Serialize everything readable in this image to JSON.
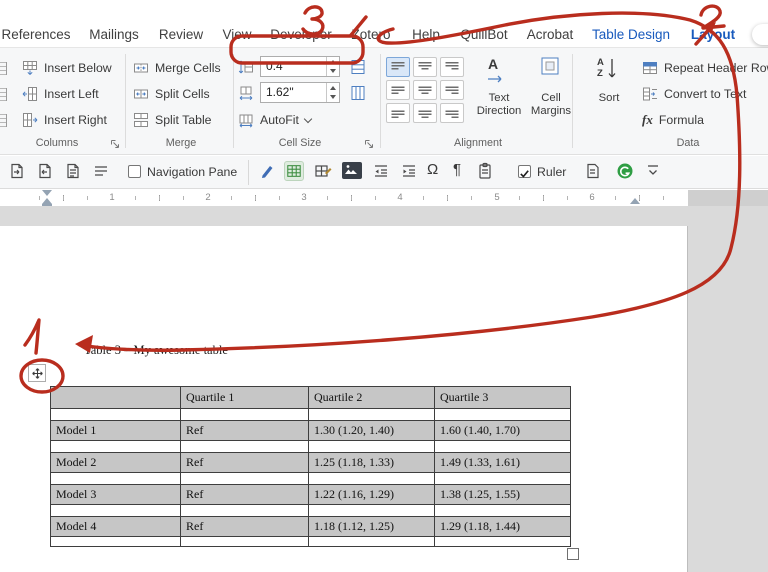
{
  "tabs": [
    "References",
    "Mailings",
    "Review",
    "View",
    "Developer",
    "Zotero",
    "Help",
    "QuillBot",
    "Acrobat",
    "Table Design",
    "Layout"
  ],
  "ribbon": {
    "columns_group": {
      "insert_below": "Insert Below",
      "insert_left": "Insert Left",
      "insert_right": "Insert Right",
      "label": "Columns"
    },
    "merge_group": {
      "merge_cells": "Merge Cells",
      "split_cells": "Split Cells",
      "split_table": "Split Table",
      "label": "Merge"
    },
    "cell_size": {
      "height_value": "0.4\"",
      "width_value": "1.62\"",
      "autofit": "AutoFit",
      "label": "Cell Size"
    },
    "alignment": {
      "a_glyph": "A",
      "text_direction_line1": "Text",
      "text_direction_line2": "Direction",
      "cell_margins_line1": "Cell",
      "cell_margins_line2": "Margins",
      "label": "Alignment"
    },
    "data_group": {
      "sort": "Sort",
      "sort_a": "A",
      "sort_z": "Z",
      "repeat_header": "Repeat Header Rows",
      "convert": "Convert to Text",
      "formula_glyph": "fx",
      "formula": "Formula",
      "label": "Data"
    }
  },
  "toolbar": {
    "navigation_pane": "Navigation Pane",
    "ruler": "Ruler",
    "omega": "Ω",
    "pilcrow": "¶",
    "badge_2": "2"
  },
  "ruler": {
    "numbers": [
      "1",
      "2",
      "3",
      "4",
      "5",
      "6"
    ]
  },
  "document": {
    "caption": "Table 3 – My awesome table",
    "table": {
      "headers": [
        "",
        "Quartile 1",
        "Quartile 2",
        "Quartile 3"
      ],
      "rows": [
        {
          "cells": [
            "Model 1",
            "Ref",
            "1.30 (1.20, 1.40)",
            "1.60 (1.40, 1.70)"
          ]
        },
        {
          "cells": [
            "Model 2",
            "Ref",
            "1.25 (1.18, 1.33)",
            "1.49 (1.33, 1.61)"
          ]
        },
        {
          "cells": [
            "Model 3",
            "Ref",
            "1.22 (1.16, 1.29)",
            "1.38 (1.25, 1.55)"
          ]
        },
        {
          "cells": [
            "Model 4",
            "Ref",
            "1.18 (1.12, 1.25)",
            "1.29 (1.18, 1.44)"
          ]
        }
      ]
    }
  },
  "annotations": {
    "labels": [
      "1",
      "2",
      "3"
    ],
    "color": "#b92d1e"
  }
}
